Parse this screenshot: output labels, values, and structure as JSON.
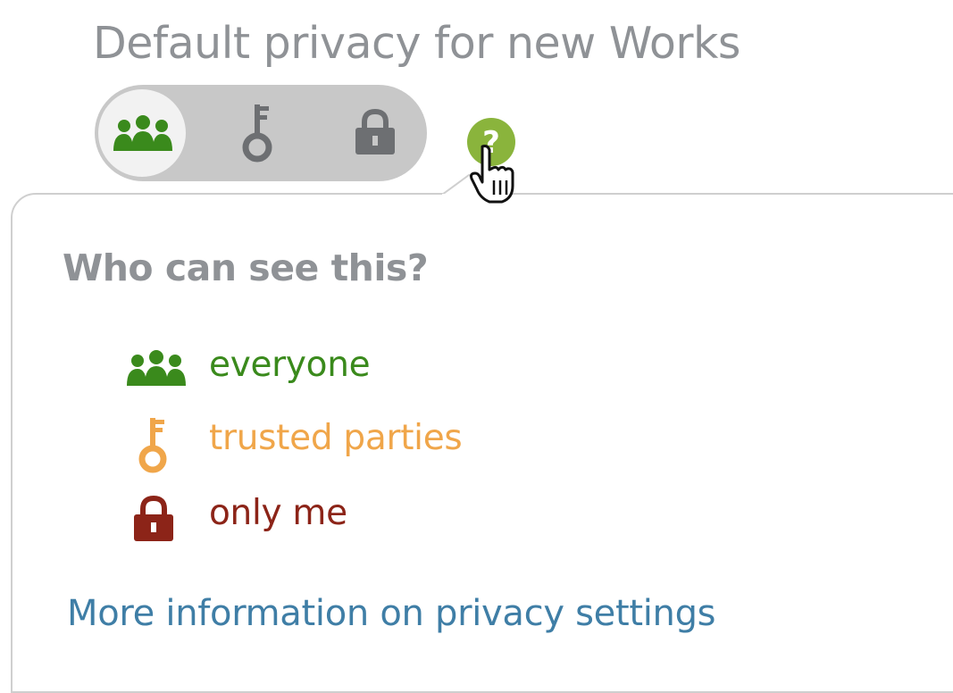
{
  "title": "Default privacy for new Works",
  "toggle": {
    "options": [
      {
        "label": "everyone",
        "icon": "people-icon",
        "active": true
      },
      {
        "label": "trusted parties",
        "icon": "key-icon",
        "active": false
      },
      {
        "label": "only me",
        "icon": "lock-icon",
        "active": false
      }
    ]
  },
  "help": {
    "icon": "question-icon"
  },
  "popover": {
    "heading": "Who can see this?",
    "items": [
      {
        "label": "everyone",
        "icon": "people-icon",
        "color": "#3a8a1c"
      },
      {
        "label": "trusted parties",
        "icon": "key-icon",
        "color": "#f0a64a"
      },
      {
        "label": "only me",
        "icon": "lock-icon",
        "color": "#8c2418"
      }
    ],
    "link": "More information on privacy settings"
  },
  "colors": {
    "everyone": "#3a8a1c",
    "trusted": "#f0a64a",
    "only_me": "#8c2418",
    "link": "#3f7ea6",
    "help": "#8ab43c"
  }
}
